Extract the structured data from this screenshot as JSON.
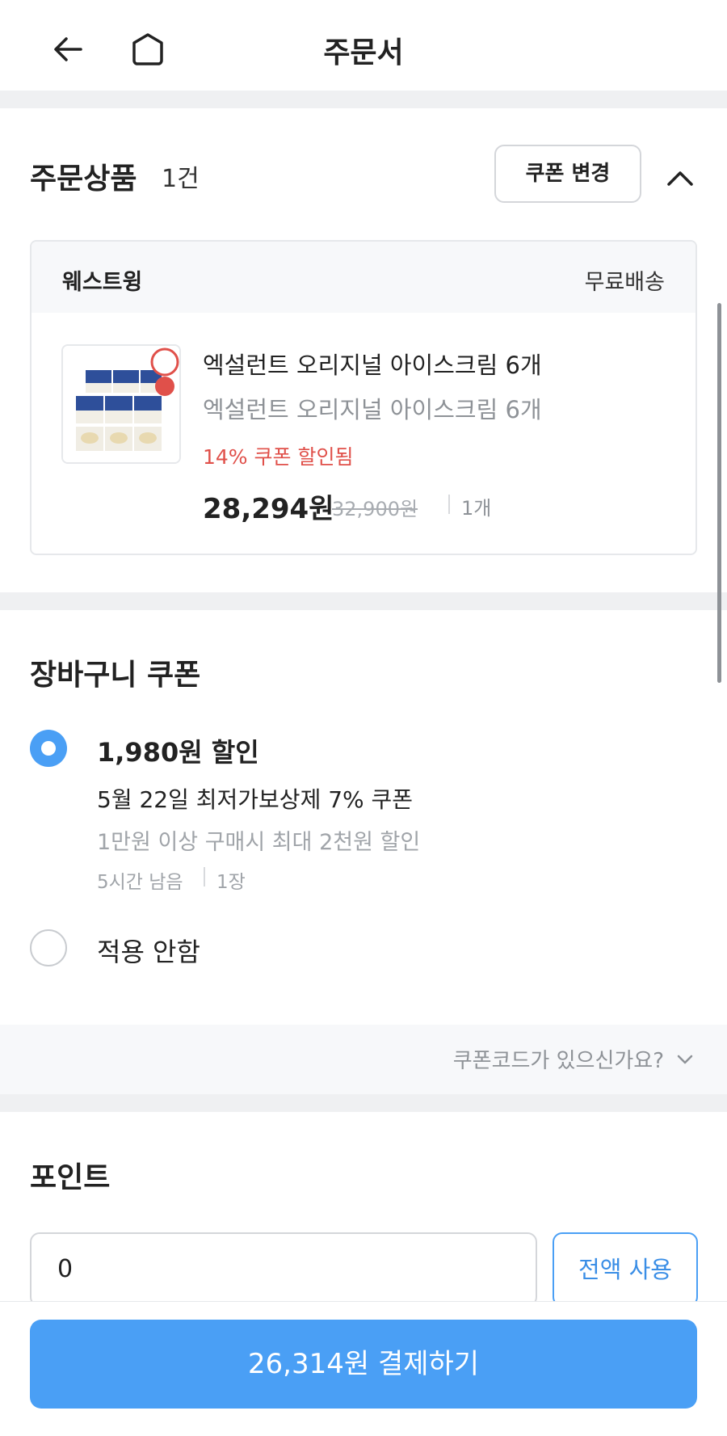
{
  "header": {
    "title": "주문서",
    "back_icon": "arrow-left-icon",
    "home_icon": "home-icon"
  },
  "order_items": {
    "title": "주문상품",
    "count": "1건",
    "coupon_change_label": "쿠폰 변경",
    "collapse_icon": "chevron-up-icon",
    "seller": "웨스트윙",
    "shipping": "무료배송",
    "product": {
      "name": "엑설런트 오리지널 아이스크림 6개",
      "option": "엑설런트 오리지널 아이스크림 6개",
      "discount": "14% 쿠폰 할인됨",
      "price": "28,294원",
      "original_price": "32,900원",
      "quantity": "1개"
    }
  },
  "cart_coupon": {
    "title": "장바구니 쿠폰",
    "options": [
      {
        "amount": "1,980원 할인",
        "name": "5월 22일 최저가보상제 7% 쿠폰",
        "condition": "1만원 이상 구매시 최대 2천원 할인",
        "time_left": "5시간 남음",
        "count": "1장",
        "selected": true
      },
      {
        "label": "적용 안함",
        "selected": false
      }
    ],
    "coupon_code_link": "쿠폰코드가 있으신가요?"
  },
  "points": {
    "title": "포인트",
    "value": "0",
    "use_all_label": "전액 사용"
  },
  "pay": {
    "label": "26,314원 결제하기"
  },
  "colors": {
    "accent": "#4a9ff5",
    "discount": "#e0504a",
    "divider": "#eff0f2"
  }
}
